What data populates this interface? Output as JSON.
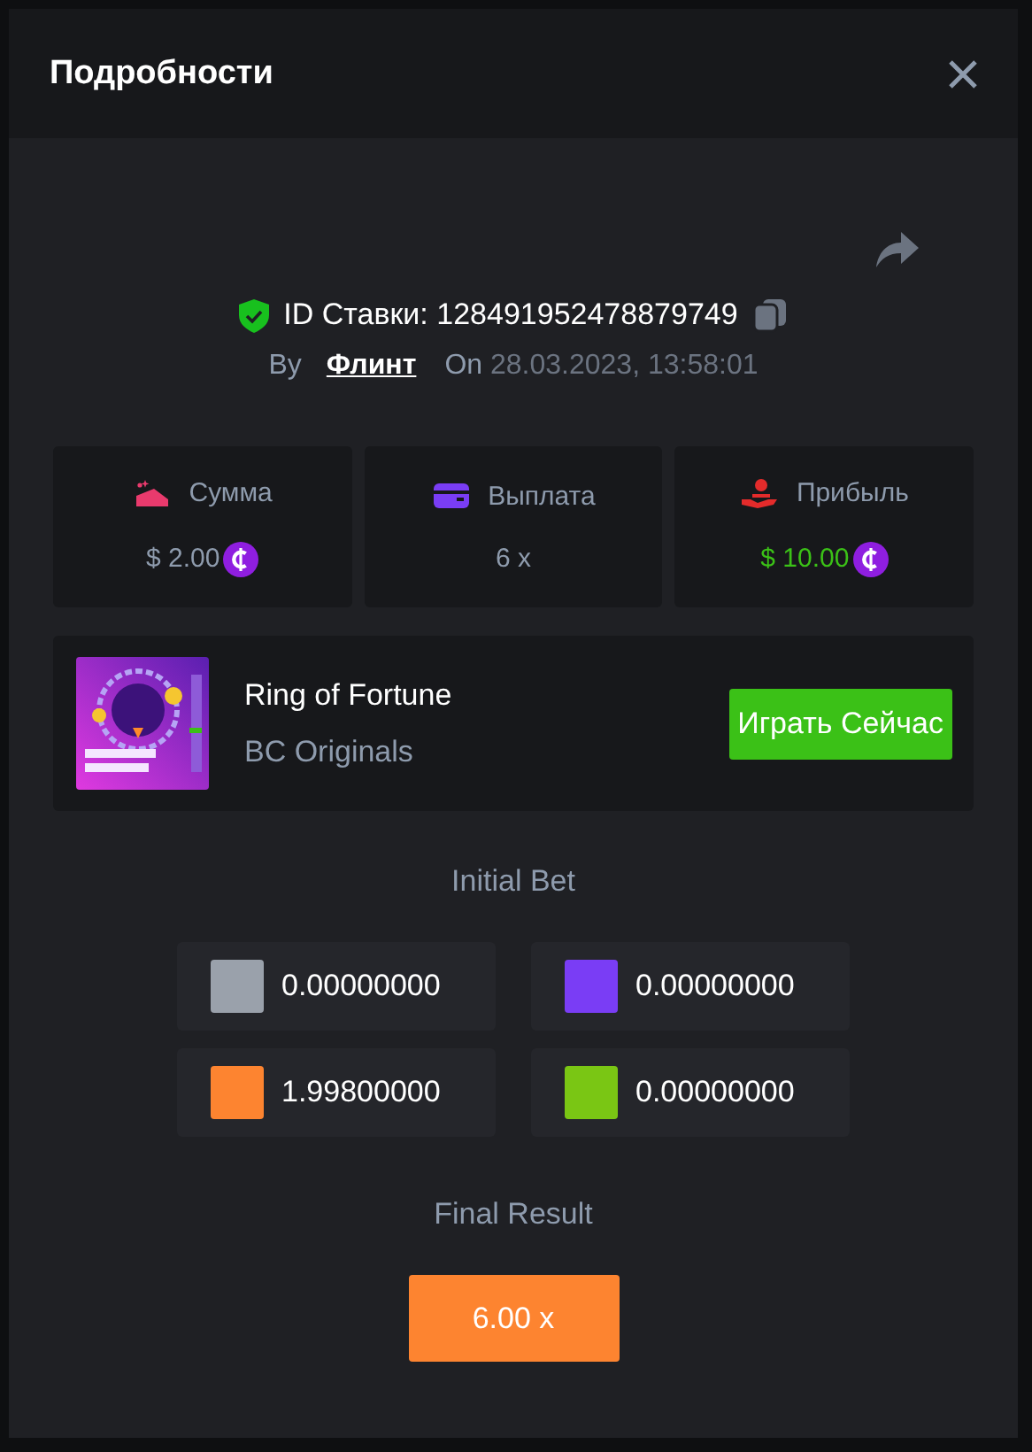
{
  "modal": {
    "title": "Подробности"
  },
  "bet": {
    "id_label": "ID Ставки:",
    "id": "128491952478879749",
    "verified": true,
    "by_label": "By",
    "user": "Флинт",
    "on_label": "On",
    "date": "28.03.2023, 13:58:01"
  },
  "stats": [
    {
      "kind": "amount",
      "label": "Сумма",
      "value": "$ 2.00",
      "coin": true
    },
    {
      "kind": "payout",
      "label": "Выплата",
      "value": "6 x",
      "coin": false
    },
    {
      "kind": "profit",
      "label": "Прибыль",
      "value": "$ 10.00",
      "coin": true
    }
  ],
  "game": {
    "kind": "picture",
    "name": "Ring of Fortune",
    "provider": "BC Originals",
    "play_button": "Играть Сейчас"
  },
  "initial_bet": {
    "title": "Initial Bet",
    "chips": [
      {
        "color": "#9aa1ab",
        "value": "0.00000000"
      },
      {
        "color": "#7a3df5",
        "value": "0.00000000"
      },
      {
        "color": "#fd8430",
        "value": "1.99800000"
      },
      {
        "color": "#7ac614",
        "value": "0.00000000"
      }
    ]
  },
  "final_result": {
    "title": "Final Result",
    "value": "6.00 x",
    "color": "#fd8430"
  }
}
